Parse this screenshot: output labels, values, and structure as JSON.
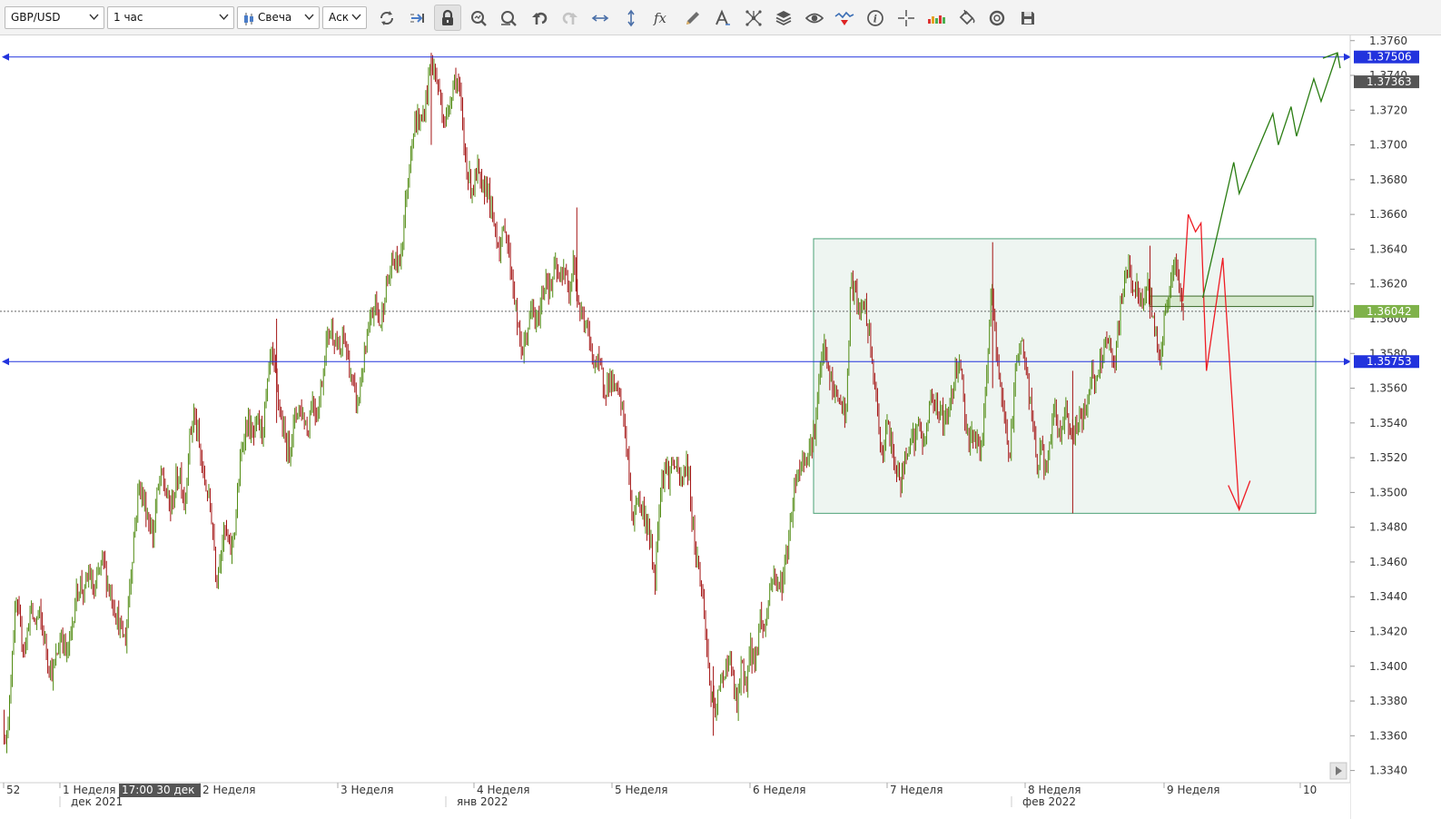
{
  "toolbar": {
    "symbol": "GBP/USD",
    "timeframe": "1 час",
    "chart_type": "Свеча",
    "price_type": "Аск",
    "icons": [
      "refresh-icon",
      "autoscroll-icon",
      "lock-icon",
      "zoom-in-icon",
      "zoom-out-icon",
      "undo-icon",
      "redo-icon",
      "horizontal-fit-icon",
      "vertical-fit-icon",
      "formula-icon",
      "pencil-icon",
      "text-tool-icon",
      "hub-icon",
      "layers-icon",
      "eye-icon",
      "signal-icon",
      "info-icon",
      "crosshair-icon",
      "volume-icon",
      "paint-bucket-icon",
      "cycle-icon",
      "save-icon"
    ]
  },
  "colors": {
    "candle_up": "#4f8a10",
    "candle_down": "#a31212",
    "hline": "#2233dd",
    "forecast_red": "#ee1c24",
    "forecast_green": "#2a7d12",
    "box_fill": "#e8f2ec",
    "box_stroke": "#4aa176",
    "current_price_tag": "#7fb24a"
  },
  "chart_data": {
    "type": "candlestick",
    "symbol": "GBP/USD",
    "timeframe": "1 час",
    "ylim": [
      1.3333,
      1.3763
    ],
    "yticks": [
      "1.3760",
      "1.3740",
      "1.3720",
      "1.3700",
      "1.3680",
      "1.3660",
      "1.3640",
      "1.3620",
      "1.3600",
      "1.3580",
      "1.3560",
      "1.3540",
      "1.3520",
      "1.3500",
      "1.3480",
      "1.3460",
      "1.3440",
      "1.3420",
      "1.3400",
      "1.3380",
      "1.3360",
      "1.3340"
    ],
    "week_labels": [
      "52",
      "1 Неделя",
      "2 Неделя",
      "3 Неделя",
      "4 Неделя",
      "5 Неделя",
      "6 Неделя",
      "7 Неделя",
      "8 Неделя",
      "9 Неделя",
      "10"
    ],
    "month_labels": [
      "дек 2021",
      "янв 2022",
      "фев 2022"
    ],
    "crosshair_time_label": "17:00 30 дек",
    "price_tags": [
      {
        "price": 1.37506,
        "label": "1.37506",
        "color": "#2233dd"
      },
      {
        "price": 1.37363,
        "label": "1.37363",
        "color": "#555555"
      },
      {
        "price": 1.36042,
        "label": "1.36042",
        "color": "#7fb24a"
      },
      {
        "price": 1.35753,
        "label": "1.35753",
        "color": "#2233dd"
      }
    ],
    "horizontal_lines": [
      1.37506,
      1.35753
    ],
    "current_price": 1.36042,
    "range_box": {
      "price_top": 1.3646,
      "price_bottom": 1.3488
    },
    "small_box": {
      "price_top": 1.3613,
      "price_bottom": 1.3607
    },
    "price_path": [
      [
        0,
        1.337
      ],
      [
        5,
        1.3355
      ],
      [
        10,
        1.3408
      ],
      [
        15,
        1.3435
      ],
      [
        20,
        1.3418
      ],
      [
        25,
        1.341
      ],
      [
        30,
        1.3433
      ],
      [
        35,
        1.3425
      ],
      [
        40,
        1.343
      ],
      [
        45,
        1.3418
      ],
      [
        50,
        1.3403
      ],
      [
        55,
        1.3395
      ],
      [
        60,
        1.3408
      ],
      [
        65,
        1.342
      ],
      [
        70,
        1.3405
      ],
      [
        75,
        1.3418
      ],
      [
        80,
        1.344
      ],
      [
        85,
        1.3448
      ],
      [
        90,
        1.3442
      ],
      [
        95,
        1.3455
      ],
      [
        100,
        1.344
      ],
      [
        105,
        1.3452
      ],
      [
        110,
        1.3462
      ],
      [
        115,
        1.3448
      ],
      [
        120,
        1.344
      ],
      [
        125,
        1.343
      ],
      [
        130,
        1.342
      ],
      [
        135,
        1.3415
      ],
      [
        140,
        1.345
      ],
      [
        145,
        1.348
      ],
      [
        150,
        1.3505
      ],
      [
        155,
        1.3495
      ],
      [
        160,
        1.3485
      ],
      [
        165,
        1.3475
      ],
      [
        170,
        1.35
      ],
      [
        175,
        1.351
      ],
      [
        180,
        1.3498
      ],
      [
        185,
        1.349
      ],
      [
        190,
        1.3505
      ],
      [
        195,
        1.3512
      ],
      [
        200,
        1.3492
      ],
      [
        205,
        1.353
      ],
      [
        210,
        1.3545
      ],
      [
        215,
        1.353
      ],
      [
        220,
        1.351
      ],
      [
        225,
        1.35
      ],
      [
        230,
        1.3485
      ],
      [
        235,
        1.345
      ],
      [
        240,
        1.347
      ],
      [
        245,
        1.3478
      ],
      [
        250,
        1.3465
      ],
      [
        255,
        1.348
      ],
      [
        260,
        1.351
      ],
      [
        265,
        1.3535
      ],
      [
        270,
        1.354
      ],
      [
        275,
        1.353
      ],
      [
        280,
        1.354
      ],
      [
        285,
        1.3535
      ],
      [
        290,
        1.3555
      ],
      [
        295,
        1.358
      ],
      [
        300,
        1.3565
      ],
      [
        305,
        1.3545
      ],
      [
        310,
        1.353
      ],
      [
        315,
        1.3525
      ],
      [
        320,
        1.354
      ],
      [
        325,
        1.355
      ],
      [
        330,
        1.3545
      ],
      [
        335,
        1.3535
      ],
      [
        340,
        1.3555
      ],
      [
        345,
        1.3545
      ],
      [
        350,
        1.356
      ],
      [
        355,
        1.3585
      ],
      [
        360,
        1.3595
      ],
      [
        365,
        1.359
      ],
      [
        370,
        1.3578
      ],
      [
        375,
        1.359
      ],
      [
        380,
        1.3575
      ],
      [
        385,
        1.356
      ],
      [
        390,
        1.355
      ],
      [
        395,
        1.357
      ],
      [
        400,
        1.3585
      ],
      [
        405,
        1.36
      ],
      [
        410,
        1.361
      ],
      [
        415,
        1.3595
      ],
      [
        420,
        1.3615
      ],
      [
        425,
        1.3625
      ],
      [
        430,
        1.3635
      ],
      [
        435,
        1.363
      ],
      [
        440,
        1.365
      ],
      [
        445,
        1.368
      ],
      [
        450,
        1.3705
      ],
      [
        455,
        1.3715
      ],
      [
        460,
        1.3712
      ],
      [
        465,
        1.3725
      ],
      [
        470,
        1.3748
      ],
      [
        473,
        1.3745
      ],
      [
        478,
        1.3735
      ],
      [
        483,
        1.372
      ],
      [
        487,
        1.3712
      ],
      [
        492,
        1.3728
      ],
      [
        497,
        1.374
      ],
      [
        502,
        1.373
      ],
      [
        507,
        1.37
      ],
      [
        512,
        1.368
      ],
      [
        517,
        1.3675
      ],
      [
        522,
        1.3685
      ],
      [
        527,
        1.367
      ],
      [
        532,
        1.368
      ],
      [
        537,
        1.366
      ],
      [
        542,
        1.365
      ],
      [
        547,
        1.364
      ],
      [
        552,
        1.3655
      ],
      [
        557,
        1.3635
      ],
      [
        562,
        1.3615
      ],
      [
        567,
        1.359
      ],
      [
        572,
        1.358
      ],
      [
        577,
        1.3595
      ],
      [
        582,
        1.3605
      ],
      [
        587,
        1.3595
      ],
      [
        592,
        1.361
      ],
      [
        597,
        1.3625
      ],
      [
        602,
        1.3615
      ],
      [
        607,
        1.363
      ],
      [
        612,
        1.362
      ],
      [
        617,
        1.3632
      ],
      [
        622,
        1.361
      ],
      [
        627,
        1.364
      ],
      [
        632,
        1.361
      ],
      [
        637,
        1.36
      ],
      [
        642,
        1.3595
      ],
      [
        647,
        1.358
      ],
      [
        652,
        1.3575
      ],
      [
        657,
        1.357
      ],
      [
        662,
        1.356
      ],
      [
        667,
        1.3565
      ],
      [
        672,
        1.356
      ],
      [
        677,
        1.3555
      ],
      [
        682,
        1.3545
      ],
      [
        687,
        1.352
      ],
      [
        692,
        1.348
      ],
      [
        697,
        1.35
      ],
      [
        702,
        1.349
      ],
      [
        707,
        1.3485
      ],
      [
        712,
        1.347
      ],
      [
        717,
        1.345
      ],
      [
        722,
        1.35
      ],
      [
        727,
        1.3515
      ],
      [
        732,
        1.351
      ],
      [
        737,
        1.3518
      ],
      [
        742,
        1.351
      ],
      [
        747,
        1.3505
      ],
      [
        752,
        1.352
      ],
      [
        757,
        1.349
      ],
      [
        762,
        1.3465
      ],
      [
        767,
        1.345
      ],
      [
        772,
        1.3425
      ],
      [
        777,
        1.339
      ],
      [
        782,
        1.337
      ],
      [
        787,
        1.3385
      ],
      [
        792,
        1.3395
      ],
      [
        797,
        1.3405
      ],
      [
        802,
        1.3395
      ],
      [
        807,
        1.3375
      ],
      [
        812,
        1.34
      ],
      [
        817,
        1.339
      ],
      [
        822,
        1.341
      ],
      [
        827,
        1.34
      ],
      [
        832,
        1.343
      ],
      [
        837,
        1.342
      ],
      [
        842,
        1.344
      ],
      [
        847,
        1.3455
      ],
      [
        852,
        1.3445
      ],
      [
        857,
        1.345
      ],
      [
        862,
        1.3465
      ],
      [
        867,
        1.349
      ],
      [
        872,
        1.351
      ],
      [
        877,
        1.3515
      ],
      [
        882,
        1.3522
      ],
      [
        887,
        1.3525
      ],
      [
        892,
        1.3535
      ],
      [
        897,
        1.356
      ],
      [
        902,
        1.3585
      ],
      [
        907,
        1.357
      ],
      [
        912,
        1.356
      ],
      [
        917,
        1.3555
      ],
      [
        922,
        1.355
      ],
      [
        927,
        1.3545
      ],
      [
        932,
        1.362
      ],
      [
        937,
        1.3615
      ],
      [
        942,
        1.36
      ],
      [
        947,
        1.361
      ],
      [
        952,
        1.359
      ],
      [
        957,
        1.357
      ],
      [
        962,
        1.354
      ],
      [
        967,
        1.352
      ],
      [
        972,
        1.354
      ],
      [
        977,
        1.3525
      ],
      [
        982,
        1.3515
      ],
      [
        987,
        1.3505
      ],
      [
        992,
        1.352
      ],
      [
        997,
        1.3535
      ],
      [
        1002,
        1.353
      ],
      [
        1007,
        1.354
      ],
      [
        1012,
        1.3525
      ],
      [
        1017,
        1.3545
      ],
      [
        1022,
        1.3555
      ],
      [
        1027,
        1.355
      ],
      [
        1032,
        1.3545
      ],
      [
        1037,
        1.354
      ],
      [
        1042,
        1.3555
      ],
      [
        1047,
        1.357
      ],
      [
        1052,
        1.358
      ],
      [
        1057,
        1.3545
      ],
      [
        1062,
        1.353
      ],
      [
        1067,
        1.3535
      ],
      [
        1072,
        1.3525
      ],
      [
        1077,
        1.353
      ],
      [
        1082,
        1.357
      ],
      [
        1087,
        1.362
      ],
      [
        1092,
        1.358
      ],
      [
        1097,
        1.356
      ],
      [
        1102,
        1.354
      ],
      [
        1107,
        1.352
      ],
      [
        1112,
        1.356
      ],
      [
        1117,
        1.359
      ],
      [
        1122,
        1.358
      ],
      [
        1127,
        1.356
      ],
      [
        1132,
        1.354
      ],
      [
        1137,
        1.3515
      ],
      [
        1142,
        1.3525
      ],
      [
        1147,
        1.351
      ],
      [
        1152,
        1.3535
      ],
      [
        1157,
        1.3545
      ],
      [
        1162,
        1.353
      ],
      [
        1167,
        1.355
      ],
      [
        1172,
        1.354
      ],
      [
        1177,
        1.353
      ],
      [
        1182,
        1.3545
      ],
      [
        1187,
        1.354
      ],
      [
        1192,
        1.3555
      ],
      [
        1197,
        1.357
      ],
      [
        1202,
        1.356
      ],
      [
        1207,
        1.3575
      ],
      [
        1212,
        1.359
      ],
      [
        1217,
        1.358
      ],
      [
        1222,
        1.357
      ],
      [
        1227,
        1.36
      ],
      [
        1232,
        1.362
      ],
      [
        1237,
        1.363
      ],
      [
        1242,
        1.362
      ],
      [
        1247,
        1.3615
      ],
      [
        1252,
        1.3605
      ],
      [
        1257,
        1.362
      ],
      [
        1262,
        1.361
      ],
      [
        1267,
        1.359
      ],
      [
        1272,
        1.358
      ],
      [
        1277,
        1.36
      ],
      [
        1282,
        1.3615
      ],
      [
        1287,
        1.363
      ],
      [
        1292,
        1.3625
      ],
      [
        1296,
        1.3604
      ]
    ],
    "forecast_red": [
      [
        1296,
        1.361
      ],
      [
        1302,
        1.366
      ],
      [
        1310,
        1.365
      ],
      [
        1316,
        1.3655
      ],
      [
        1322,
        1.357
      ],
      [
        1340,
        1.3635
      ],
      [
        1358,
        1.349
      ]
    ],
    "forecast_green": [
      [
        1318,
        1.3612
      ],
      [
        1352,
        1.369
      ],
      [
        1358,
        1.3672
      ],
      [
        1395,
        1.3718
      ],
      [
        1401,
        1.37
      ],
      [
        1415,
        1.3722
      ],
      [
        1421,
        1.3705
      ],
      [
        1440,
        1.3738
      ],
      [
        1448,
        1.3725
      ],
      [
        1466,
        1.3753
      ]
    ],
    "axis_values": {
      "x_scale": "bar_index",
      "x_range": [
        0,
        1480
      ]
    }
  }
}
